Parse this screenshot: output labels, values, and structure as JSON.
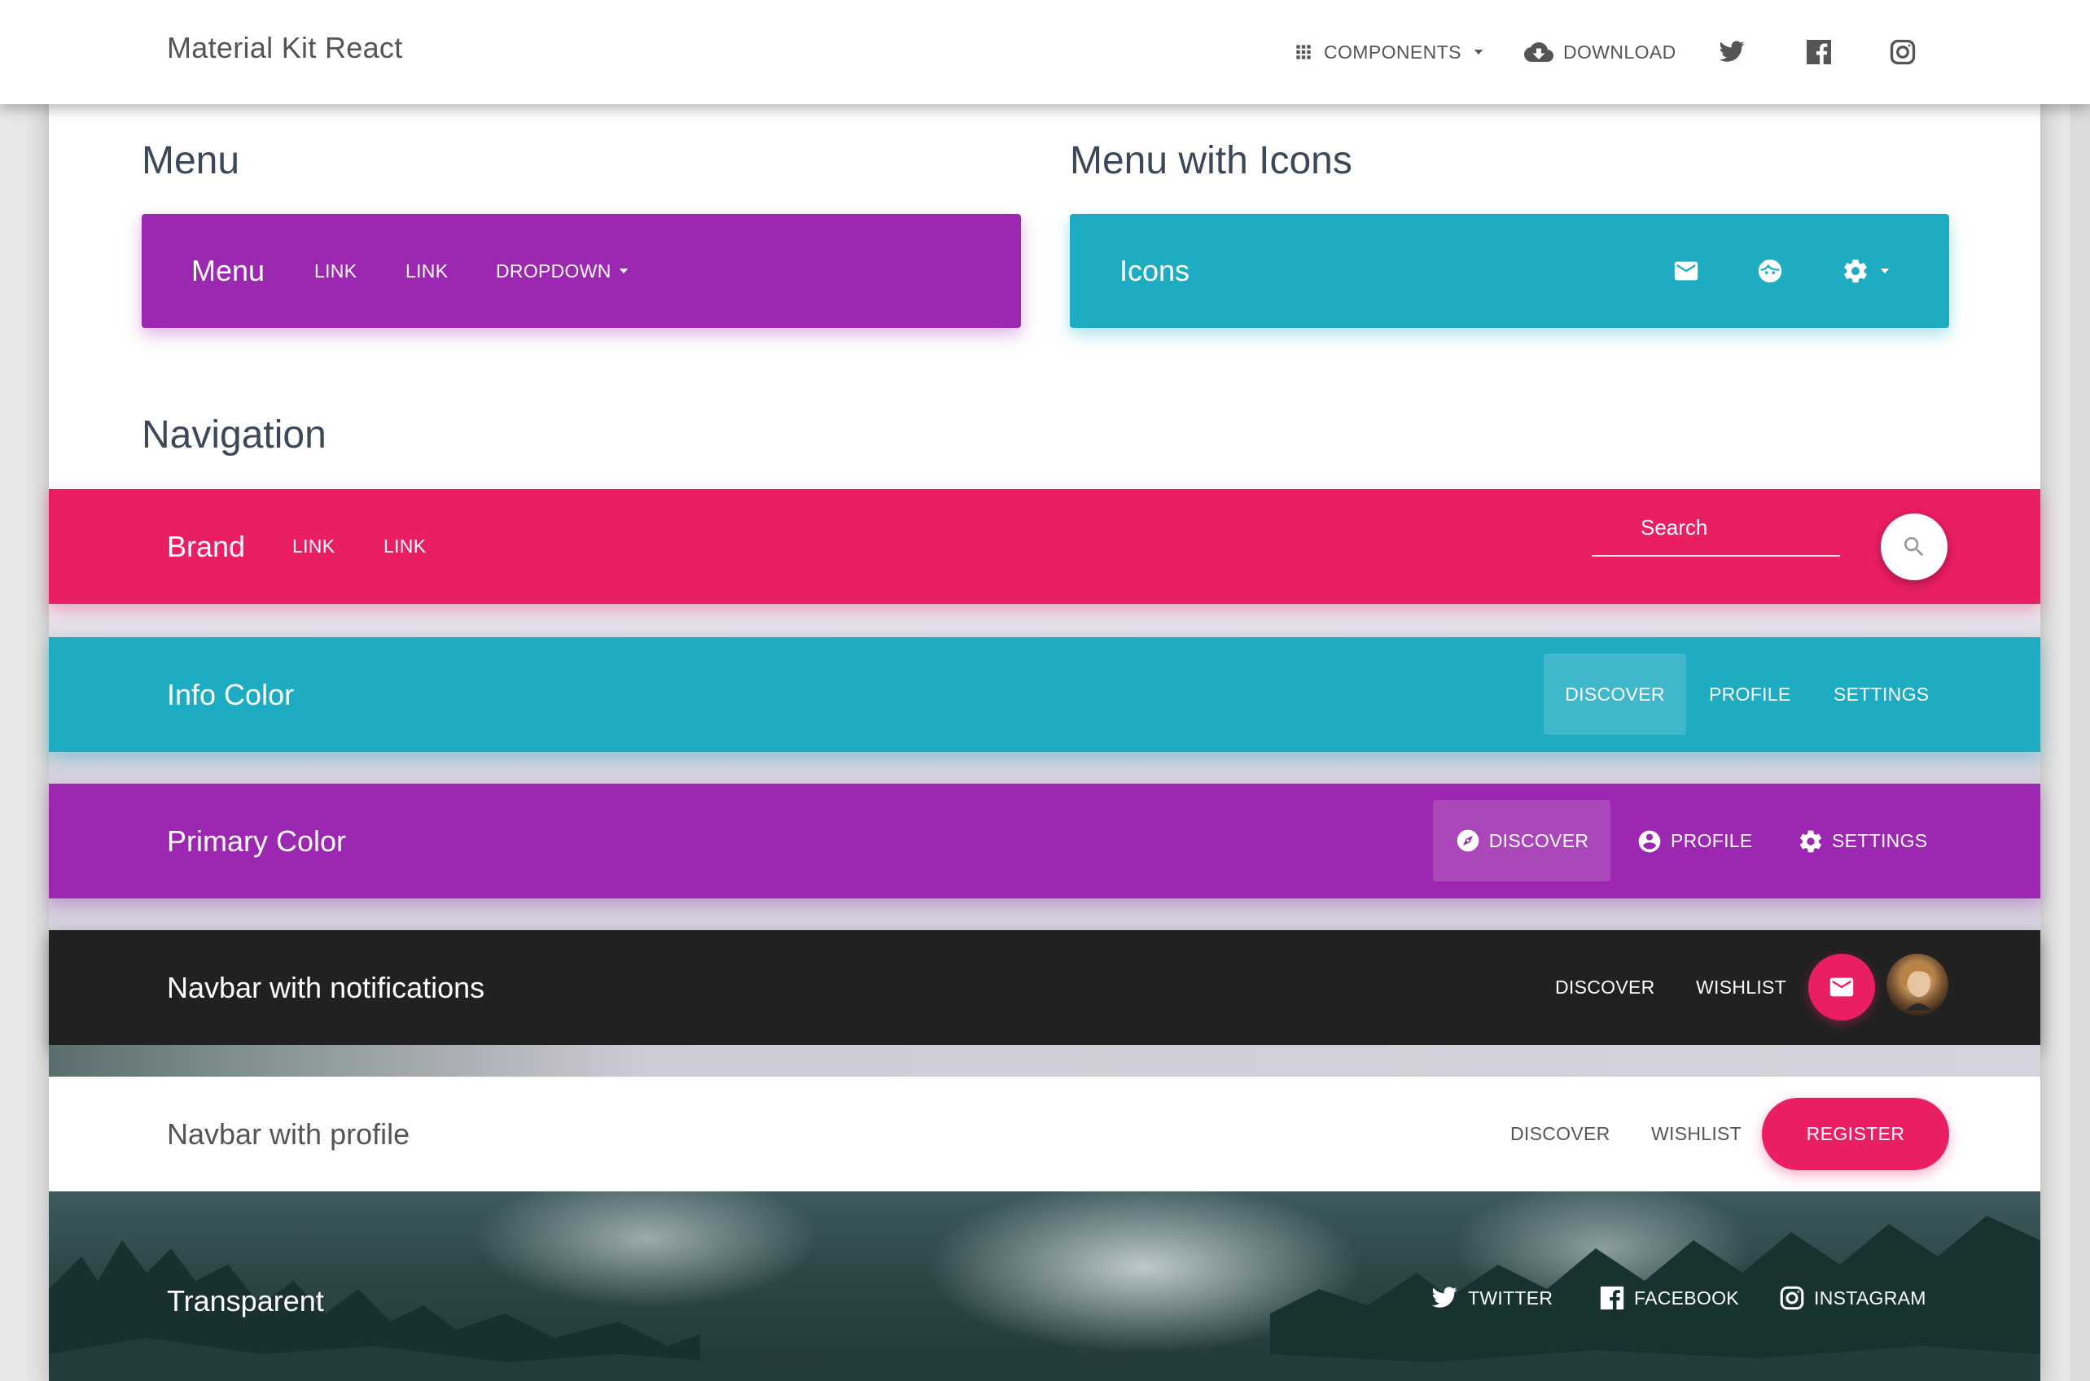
{
  "header": {
    "brand": "Material Kit React",
    "components_label": "COMPONENTS",
    "download_label": "DOWNLOAD",
    "social_icons": [
      "twitter-icon",
      "facebook-icon",
      "instagram-icon"
    ]
  },
  "sections": {
    "menu_title": "Menu",
    "menu_icons_title": "Menu with Icons",
    "navigation_title": "Navigation"
  },
  "menu_bar": {
    "brand": "Menu",
    "links": [
      "LINK",
      "LINK"
    ],
    "dropdown_label": "DROPDOWN",
    "color": "#9c27b0"
  },
  "icons_bar": {
    "brand": "Icons",
    "icons": [
      "mail-icon",
      "face-icon",
      "settings-icon"
    ],
    "color": "#1eacc2"
  },
  "rose_bar": {
    "brand": "Brand",
    "links": [
      "LINK",
      "LINK"
    ],
    "search_placeholder": "Search",
    "color": "#e91e63"
  },
  "info_bar": {
    "brand": "Info Color",
    "links": [
      "DISCOVER",
      "PROFILE",
      "SETTINGS"
    ],
    "active": "DISCOVER",
    "color": "#1eacc2"
  },
  "primary_bar": {
    "brand": "Primary Color",
    "links": [
      "DISCOVER",
      "PROFILE",
      "SETTINGS"
    ],
    "icons": [
      "compass-icon",
      "account-circle-icon",
      "settings-icon"
    ],
    "active": "DISCOVER",
    "color": "#9c27b0"
  },
  "dark_bar": {
    "brand": "Navbar with notifications",
    "links": [
      "DISCOVER",
      "WISHLIST"
    ],
    "color": "#212121"
  },
  "white_bar": {
    "brand": "Navbar with profile",
    "links": [
      "DISCOVER",
      "WISHLIST"
    ],
    "register_label": "REGISTER"
  },
  "transparent_bar": {
    "brand": "Transparent",
    "links": [
      "TWITTER",
      "FACEBOOK",
      "INSTAGRAM"
    ]
  }
}
